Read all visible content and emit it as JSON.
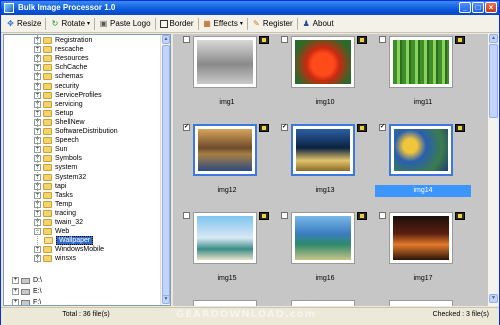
{
  "window": {
    "title": "Bulk Image Processor 1.0"
  },
  "toolbar": {
    "items": [
      {
        "label": "Resize",
        "icon": "resize-icon"
      },
      {
        "label": "Rotate",
        "icon": "rotate-icon"
      },
      {
        "label": "Paste Logo",
        "icon": "paste-logo-icon"
      },
      {
        "label": "Border",
        "icon": "border-icon"
      },
      {
        "label": "Effects",
        "icon": "effects-icon"
      },
      {
        "label": "Register",
        "icon": "register-icon"
      },
      {
        "label": "About",
        "icon": "about-icon"
      }
    ]
  },
  "tree": {
    "items": [
      "Registration",
      "rescache",
      "Resources",
      "SchCache",
      "schemas",
      "security",
      "ServiceProfiles",
      "servicing",
      "Setup",
      "ShellNew",
      "SoftwareDistribution",
      "Speech",
      "Sun",
      "Symbols",
      "system",
      "System32",
      "tapi",
      "Tasks",
      "Temp",
      "tracing",
      "twain_32",
      "Web",
      "Wallpaper",
      "WindowsMobile",
      "winsxs"
    ],
    "drives": [
      "D:\\",
      "E:\\",
      "F:\\"
    ],
    "selected": "Wallpaper"
  },
  "thumbnails": [
    {
      "name": "img1",
      "checked": false,
      "selected": false
    },
    {
      "name": "img10",
      "checked": false,
      "selected": false
    },
    {
      "name": "img11",
      "checked": false,
      "selected": false
    },
    {
      "name": "img12",
      "checked": true,
      "selected": false
    },
    {
      "name": "img13",
      "checked": true,
      "selected": false
    },
    {
      "name": "img14",
      "checked": true,
      "selected": true
    },
    {
      "name": "img15",
      "checked": false,
      "selected": false
    },
    {
      "name": "img16",
      "checked": false,
      "selected": false
    },
    {
      "name": "img17",
      "checked": false,
      "selected": false
    }
  ],
  "status": {
    "total": "Total : 36 file(s)",
    "checked": "Checked : 3 file(s)"
  },
  "watermark": "GEARDOWNLOAD.com"
}
